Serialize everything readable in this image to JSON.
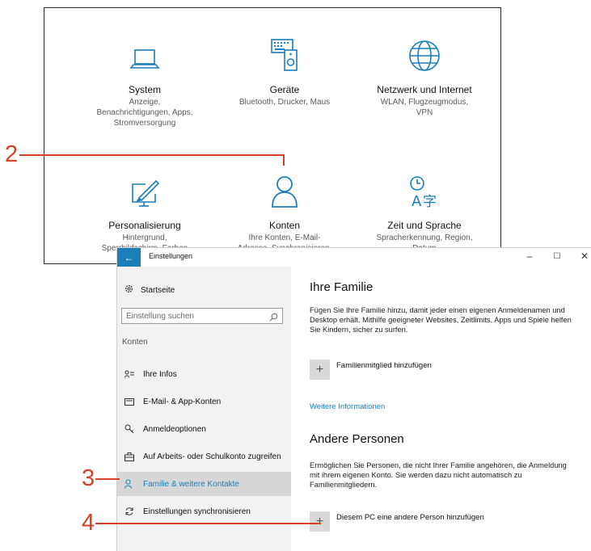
{
  "top_panel": {
    "tiles": [
      {
        "name": "System",
        "desc": "Anzeige,\nBenachrichtigungen, Apps,\nStromversorgung",
        "icon": "laptop-icon"
      },
      {
        "name": "Geräte",
        "desc": "Bluetooth, Drucker, Maus",
        "icon": "keyboard-speaker-icon"
      },
      {
        "name": "Netzwerk und Internet",
        "desc": "WLAN, Flugzeugmodus,\nVPN",
        "icon": "globe-icon"
      },
      {
        "name": "Personalisierung",
        "desc": "Hintergrund,\nSperrbildschirm, Farben",
        "icon": "paint-monitor-icon"
      },
      {
        "name": "Konten",
        "desc": "Ihre Konten, E-Mail-\nAdresse, Synchronisieren,",
        "icon": "person-icon"
      },
      {
        "name": "Zeit und Sprache",
        "desc": "Spracherkennung, Region,\nDatum",
        "icon": "time-language-icon"
      }
    ]
  },
  "callouts": {
    "two": "2",
    "three": "3",
    "four": "4"
  },
  "window": {
    "title": "Einstellungen",
    "back": "←",
    "minimize": "–",
    "maximize": "☐",
    "close": "✕",
    "accent": "#1a7fb9"
  },
  "sidebar": {
    "home": "Startseite",
    "search_placeholder": "Einstellung suchen",
    "section": "Konten",
    "items": [
      {
        "label": "Ihre Infos",
        "icon": "person-info-icon"
      },
      {
        "label": "E-Mail- & App-Konten",
        "icon": "mail-icon"
      },
      {
        "label": "Anmeldeoptionen",
        "icon": "key-icon"
      },
      {
        "label": "Auf Arbeits- oder Schulkonto zugreifen",
        "icon": "briefcase-icon"
      },
      {
        "label": "Familie & weitere Kontakte",
        "icon": "family-icon",
        "active": true
      },
      {
        "label": "Einstellungen synchronisieren",
        "icon": "sync-icon"
      }
    ]
  },
  "content": {
    "family_title": "Ihre Familie",
    "family_text": "Fügen Sie Ihre Familie hinzu, damit jeder einen eigenen Anmeldenamen und Desktop erhält. Mithilfe geeigneter Websites, Zeitlimits, Apps und Spiele helfen Sie Kindern, sicher zu surfen.",
    "add_family": "Familienmitglied hinzufügen",
    "more_info": "Weitere Informationen",
    "others_title": "Andere Personen",
    "others_text": "Ermöglichen Sie Personen, die nicht Ihrer Familie angehören, die Anmeldung mit ihrem eigenen Konto. Sie werden dazu nicht automatisch zu Familienmitgliedern.",
    "add_other": "Diesem PC eine andere Person hinzufügen",
    "plus": "+"
  }
}
